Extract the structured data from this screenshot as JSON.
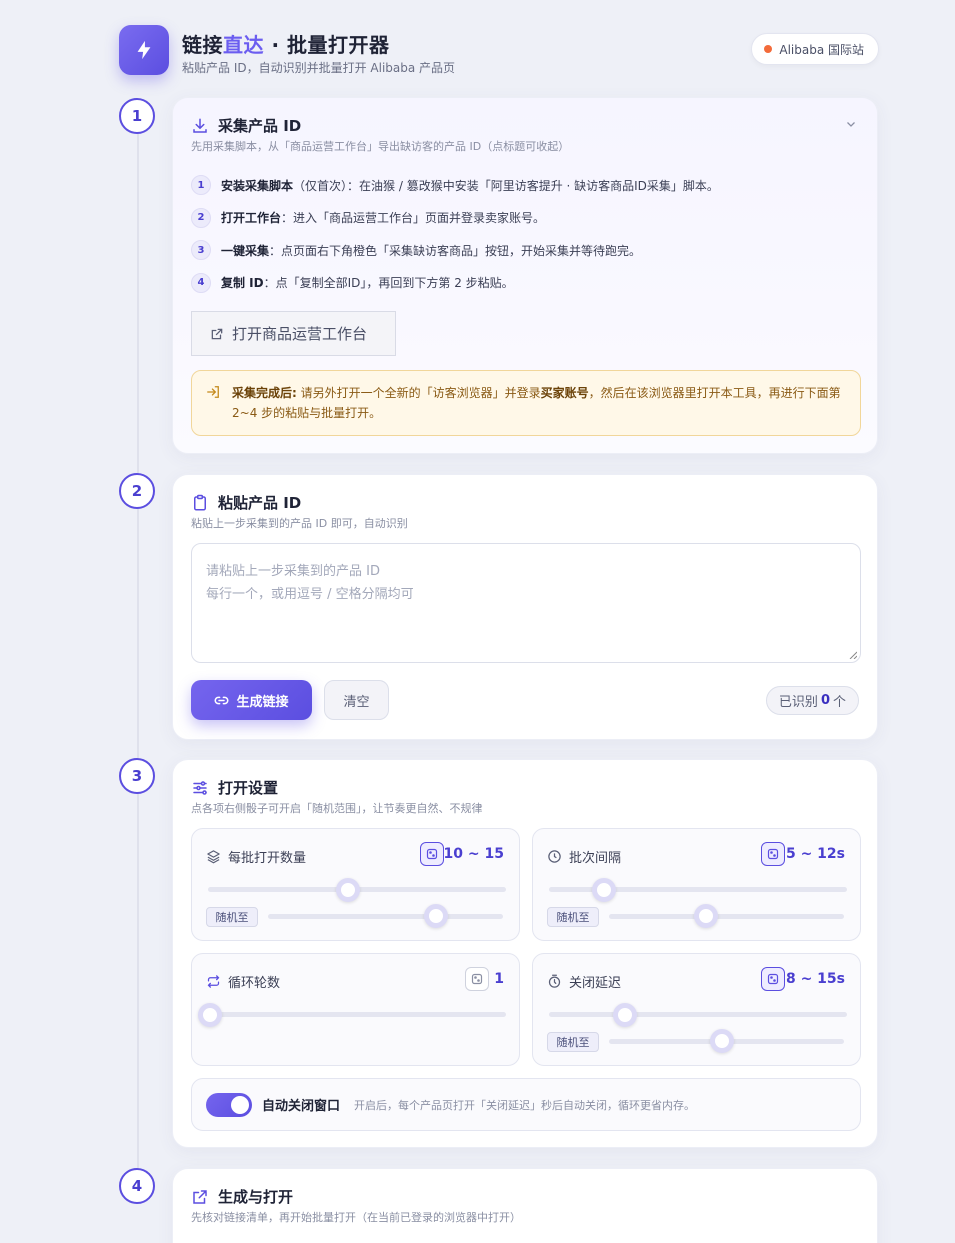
{
  "header": {
    "title_main": "链接",
    "title_accent": "直达",
    "title_rest": " · 批量打开器",
    "subtitle": "粘贴产品 ID，自动识别并批量打开 Alibaba 产品页",
    "site_label": "Alibaba 国际站"
  },
  "steps": {
    "s1": {
      "number": "1",
      "title": "采集产品 ID",
      "desc": "先用采集脚本，从「商品运营工作台」导出缺访客的产品 ID（点标题可收起）",
      "items": [
        {
          "n": "1",
          "bold": "安装采集脚本",
          "text": "（仅首次）：在油猴 / 篡改猴中安装「阿里访客提升 · 缺访客商品ID采集」脚本。"
        },
        {
          "n": "2",
          "bold": "打开工作台",
          "text": "：进入「商品运营工作台」页面并登录卖家账号。"
        },
        {
          "n": "3",
          "bold": "一键采集",
          "text": "：点页面右下角橙色「采集缺访客商品」按钮，开始采集并等待跑完。"
        },
        {
          "n": "4",
          "bold": "复制 ID",
          "text": "：点「复制全部ID」，再回到下方第 2 步粘贴。"
        }
      ],
      "open_button": "打开商品运营工作台",
      "notice_bold": "采集完成后:",
      "notice_text1": " 请另外打开一个全新的「访客浏览器」并登录",
      "notice_bold2": "买家账号",
      "notice_text2": "，然后在该浏览器里打开本工具，再进行下面第 2~4 步的粘贴与批量打开。"
    },
    "s2": {
      "number": "2",
      "title": "粘贴产品 ID",
      "desc": "粘贴上一步采集到的产品 ID 即可，自动识别",
      "placeholder_line1": "请粘贴上一步采集到的产品 ID",
      "placeholder_line2": "每行一个，或用逗号 / 空格分隔均可",
      "generate_button": "生成链接",
      "clear_button": "清空",
      "count_prefix": "已识别",
      "count_value": "0",
      "count_suffix": "个"
    },
    "s3": {
      "number": "3",
      "title": "打开设置",
      "desc": "点各项右侧骰子可开启「随机范围」，让节奏更自然、不规律",
      "random_label": "随机至",
      "settings": {
        "batch": {
          "label": "每批打开数量",
          "value": "10 ~ 15",
          "random_on": true,
          "slider": 0.47,
          "slider_random": 0.72
        },
        "interval": {
          "label": "批次间隔",
          "value": "5 ~ 12s",
          "random_on": true,
          "slider": 0.18,
          "slider_random": 0.41
        },
        "loops": {
          "label": "循环轮数",
          "value": "1",
          "random_on": false,
          "slider": 0.0
        },
        "close_delay": {
          "label": "关闭延迟",
          "value": "8 ~ 15s",
          "random_on": true,
          "slider": 0.25,
          "slider_random": 0.48
        }
      },
      "auto_close_label": "自动关闭窗口",
      "auto_close_on": true,
      "auto_close_desc": "开启后，每个产品页打开「关闭延迟」秒后自动关闭，循环更省内存。"
    },
    "s4": {
      "number": "4",
      "title": "生成与打开",
      "desc": "先核对链接清单，再开始批量打开（在当前已登录的浏览器中打开）"
    }
  },
  "colors": {
    "accent": "#5b4ee0",
    "accent_light": "#7a6cf0",
    "notice_bg": "#fff8e8",
    "site_dot": "#f36b3a"
  }
}
